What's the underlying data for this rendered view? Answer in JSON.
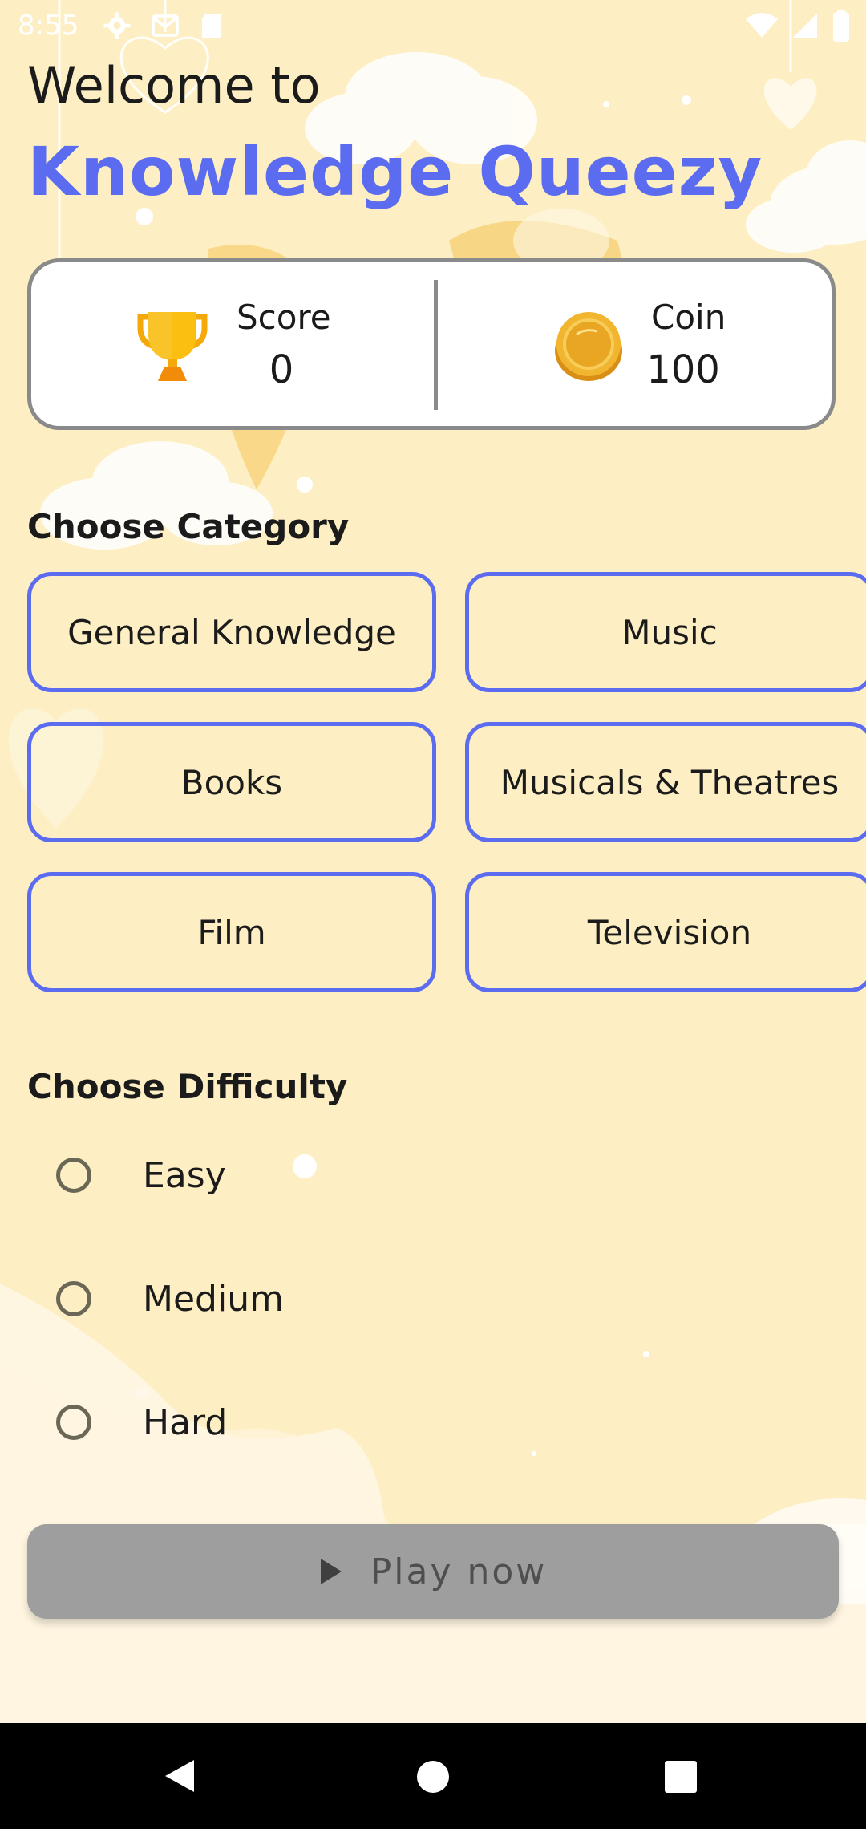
{
  "status_bar": {
    "time": "8:55",
    "icons": [
      "settings-icon",
      "gmail-icon",
      "sd-card-icon",
      "wifi-icon",
      "signal-icon",
      "battery-icon"
    ]
  },
  "header": {
    "welcome": "Welcome to",
    "title": "Knowledge Queezy"
  },
  "stats": {
    "score_label": "Score",
    "score_value": "0",
    "coin_label": "Coin",
    "coin_value": "100"
  },
  "category": {
    "title": "Choose Category",
    "items": [
      {
        "label": "General Knowledge"
      },
      {
        "label": "Music"
      },
      {
        "label": "Books"
      },
      {
        "label": "Musicals & Theatres"
      },
      {
        "label": "Film"
      },
      {
        "label": "Television"
      }
    ]
  },
  "difficulty": {
    "title": "Choose Difficulty",
    "options": [
      {
        "label": "Easy",
        "selected": false
      },
      {
        "label": "Medium",
        "selected": false
      },
      {
        "label": "Hard",
        "selected": false
      }
    ]
  },
  "play_button": {
    "label": "Play now",
    "enabled": false
  },
  "colors": {
    "accent": "#5b6cf0",
    "background": "#fdefc3",
    "button_disabled": "#9e9e9e",
    "trophy": "#f5a80a",
    "coin": "#e8a623"
  }
}
